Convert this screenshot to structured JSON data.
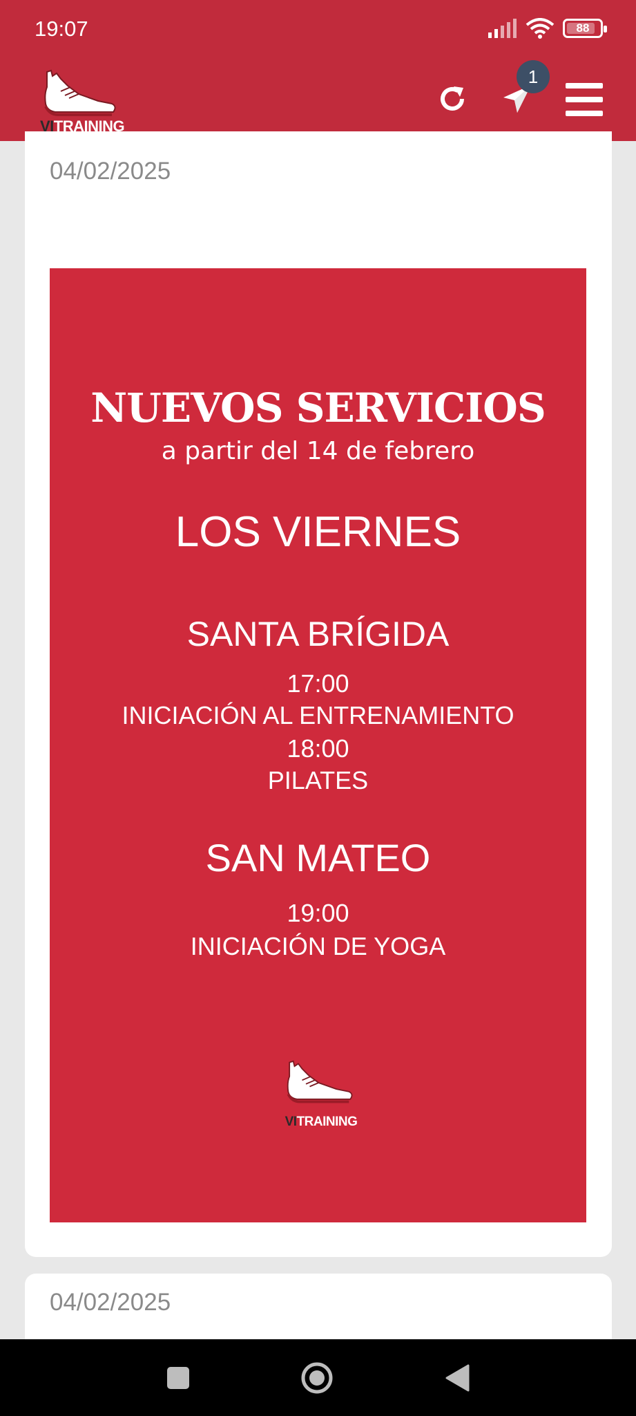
{
  "status_bar": {
    "time": "19:07",
    "battery": "88",
    "battery_level": 0.88
  },
  "app": {
    "logo_prefix": "VI",
    "logo_suffix": "TRAINING",
    "notification_count": "1",
    "colors": {
      "primary": "#c12b3c",
      "badge": "#3d4f66",
      "poster": "#cf2a3c"
    }
  },
  "posts": [
    {
      "date": "04/02/2025",
      "poster": {
        "title": "NUEVOS SERVICIOS",
        "subtitle": "a partir del 14 de febrero",
        "day": "LOS VIERNES",
        "location_1": "SANTA BRÍGIDA",
        "slot_1_time": "17:00",
        "slot_1_activity": "INICIACIÓN AL ENTRENAMIENTO",
        "slot_2_time": "18:00",
        "slot_2_activity": "PILATES",
        "location_2": "SAN MATEO",
        "slot_3_time": "19:00",
        "slot_3_activity": "INICIACIÓN DE YOGA",
        "logo_prefix": "VI",
        "logo_suffix": "TRAINING"
      }
    },
    {
      "date": "04/02/2025"
    }
  ],
  "icons": {
    "refresh": "refresh-icon",
    "send": "send-icon",
    "menu": "hamburger-menu-icon",
    "nav_recent": "square-icon",
    "nav_home": "circle-icon",
    "nav_back": "back-triangle-icon"
  }
}
